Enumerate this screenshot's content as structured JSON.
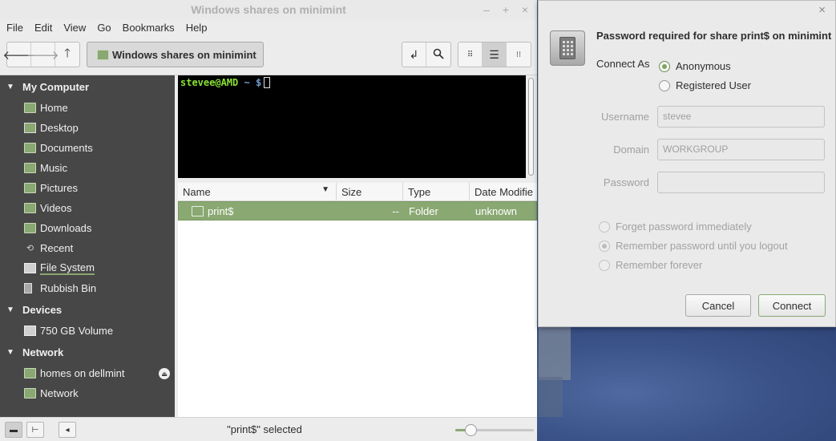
{
  "window": {
    "title": "Windows shares on minimint",
    "controls": {
      "minimize": "–",
      "maximize": "+",
      "close": "×"
    }
  },
  "menu": [
    "File",
    "Edit",
    "View",
    "Go",
    "Bookmarks",
    "Help"
  ],
  "toolbar": {
    "back_icon": "arrow-left-icon",
    "forward_icon": "arrow-right-icon",
    "up_icon": "arrow-up-icon",
    "location_label": "Windows shares on minimint",
    "toggle_location_icon": "toggle-location-icon",
    "search_icon": "search-icon",
    "views": [
      "icon-view",
      "list-view",
      "compact-view"
    ],
    "active_view": "list-view"
  },
  "sidebar": {
    "sections": [
      {
        "title": "My Computer",
        "items": [
          {
            "label": "Home",
            "icon": "home-folder-icon"
          },
          {
            "label": "Desktop",
            "icon": "desktop-icon"
          },
          {
            "label": "Documents",
            "icon": "documents-folder-icon"
          },
          {
            "label": "Music",
            "icon": "music-folder-icon"
          },
          {
            "label": "Pictures",
            "icon": "pictures-folder-icon"
          },
          {
            "label": "Videos",
            "icon": "videos-folder-icon"
          },
          {
            "label": "Downloads",
            "icon": "downloads-folder-icon"
          },
          {
            "label": "Recent",
            "icon": "recent-icon"
          },
          {
            "label": "File System",
            "icon": "drive-icon"
          },
          {
            "label": "Rubbish Bin",
            "icon": "trash-icon"
          }
        ]
      },
      {
        "title": "Devices",
        "items": [
          {
            "label": "750 GB Volume",
            "icon": "drive-icon"
          }
        ]
      },
      {
        "title": "Network",
        "items": [
          {
            "label": "homes on dellmint",
            "icon": "network-folder-icon",
            "eject": true
          },
          {
            "label": "Network",
            "icon": "network-icon"
          }
        ]
      }
    ]
  },
  "terminal": {
    "user": "stevee@AMD",
    "path": "~",
    "prompt": "$"
  },
  "list": {
    "columns": [
      "Name",
      "Size",
      "Type",
      "Date Modifie"
    ],
    "rows": [
      {
        "name": "print$",
        "size": "--",
        "type": "Folder",
        "date": "unknown",
        "selected": true
      }
    ]
  },
  "statusbar": {
    "text": "\"print$\" selected",
    "zoom_fraction": 0.2
  },
  "dialog": {
    "title": "Password required for share print$ on minimint",
    "connect_as_label": "Connect As",
    "connect_options": [
      "Anonymous",
      "Registered User"
    ],
    "connect_selected": "Anonymous",
    "fields": {
      "username_label": "Username",
      "username_value": "stevee",
      "domain_label": "Domain",
      "domain_value": "WORKGROUP",
      "password_label": "Password",
      "password_value": ""
    },
    "remember_options": [
      "Forget password immediately",
      "Remember password until you logout",
      "Remember forever"
    ],
    "remember_selected": "Remember password until you logout",
    "cancel_label": "Cancel",
    "connect_label": "Connect",
    "close_symbol": "×"
  }
}
